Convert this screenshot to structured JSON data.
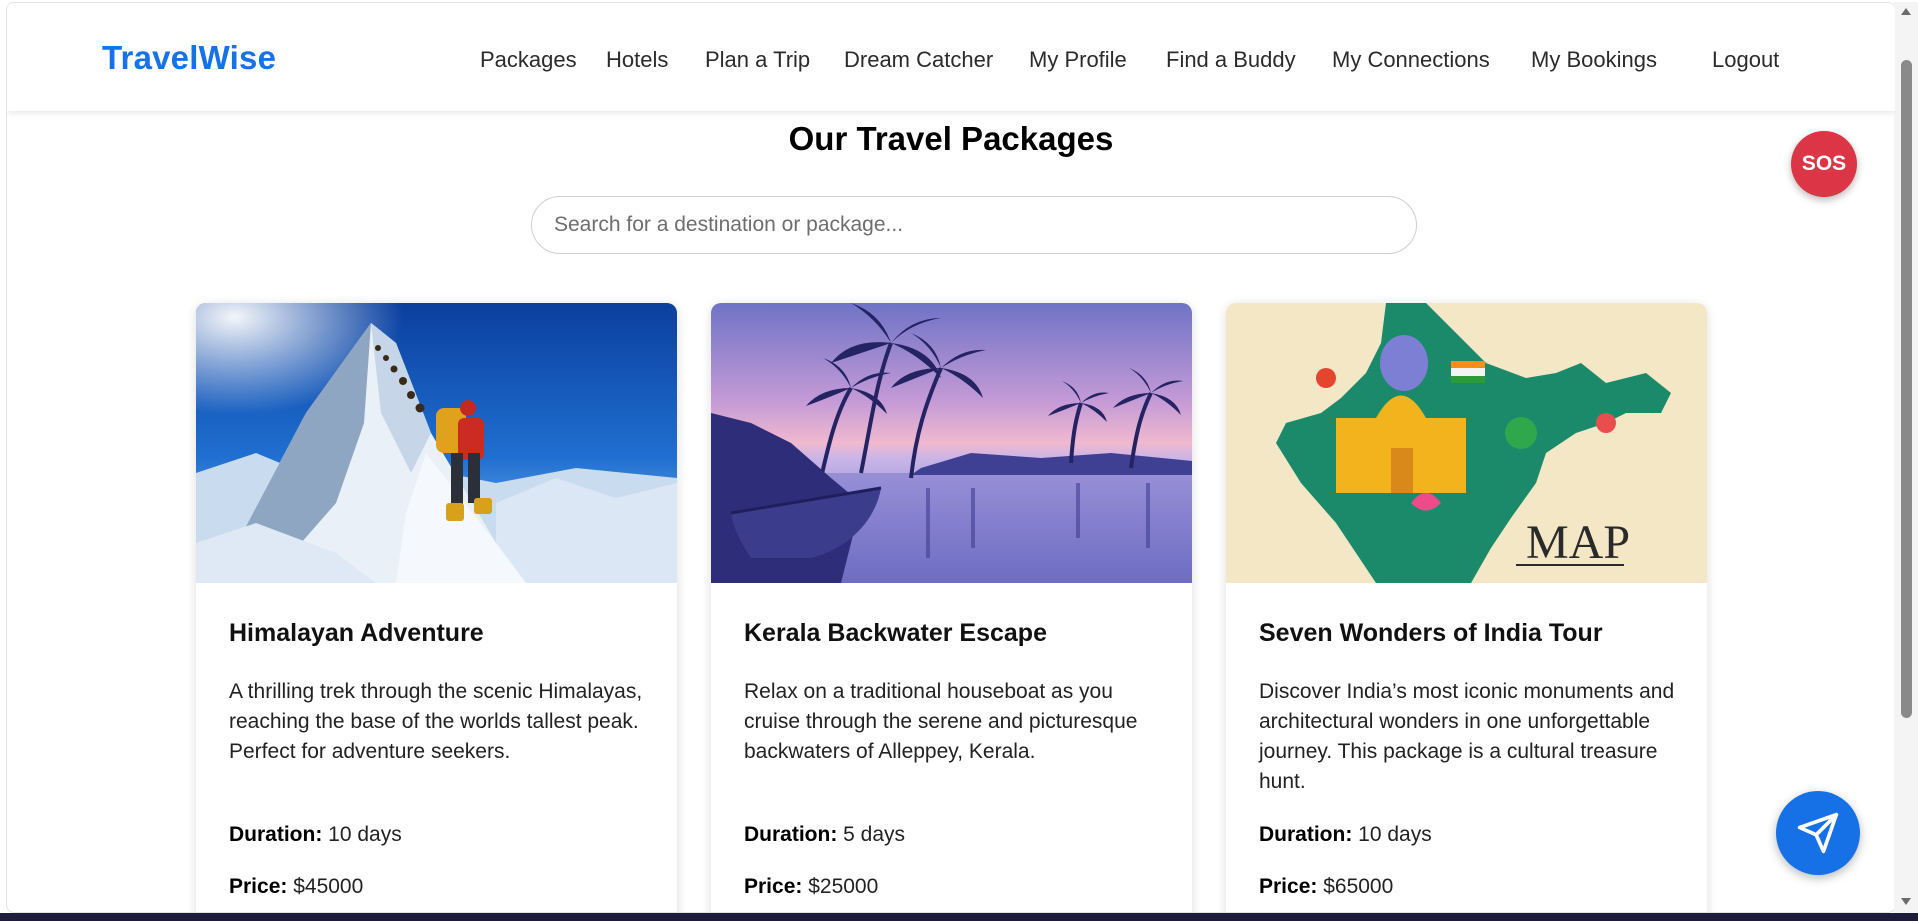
{
  "header": {
    "logo": "TravelWise",
    "nav": [
      "Packages",
      "Hotels",
      "Plan a Trip",
      "Dream Catcher",
      "My Profile",
      "Find a Buddy",
      "My Connections",
      "My Bookings",
      "Logout"
    ]
  },
  "main": {
    "title": "Our Travel Packages",
    "search": {
      "placeholder": "Search for a destination or package...",
      "value": ""
    }
  },
  "packages": [
    {
      "title": "Himalayan Adventure",
      "description": "A thrilling trek through the scenic Himalayas, reaching the base of the worlds tallest peak. Perfect for adventure seekers.",
      "duration_label": "Duration:",
      "duration": "10 days",
      "price_label": "Price:",
      "price": "$45000",
      "image": "mountain-climbers-image"
    },
    {
      "title": "Kerala Backwater Escape",
      "description": "Relax on a traditional houseboat as you cruise through the serene and picturesque backwaters of Alleppey, Kerala.",
      "duration_label": "Duration:",
      "duration": "5 days",
      "price_label": "Price:",
      "price": "$25000",
      "image": "backwaters-palm-image"
    },
    {
      "title": "Seven Wonders of India Tour",
      "description": "Discover India’s most iconic monuments and architectural wonders in one unforgettable journey. This package is a cultural treasure hunt.",
      "duration_label": "Duration:",
      "duration": "10 days",
      "price_label": "Price:",
      "price": "$65000",
      "image": "india-map-image",
      "image_text": "MAP"
    }
  ],
  "floating": {
    "sos_label": "SOS",
    "send_icon": "paper-plane-icon"
  },
  "colors": {
    "brand": "#1672e8",
    "sos": "#dc3545",
    "send": "#1670e6"
  }
}
